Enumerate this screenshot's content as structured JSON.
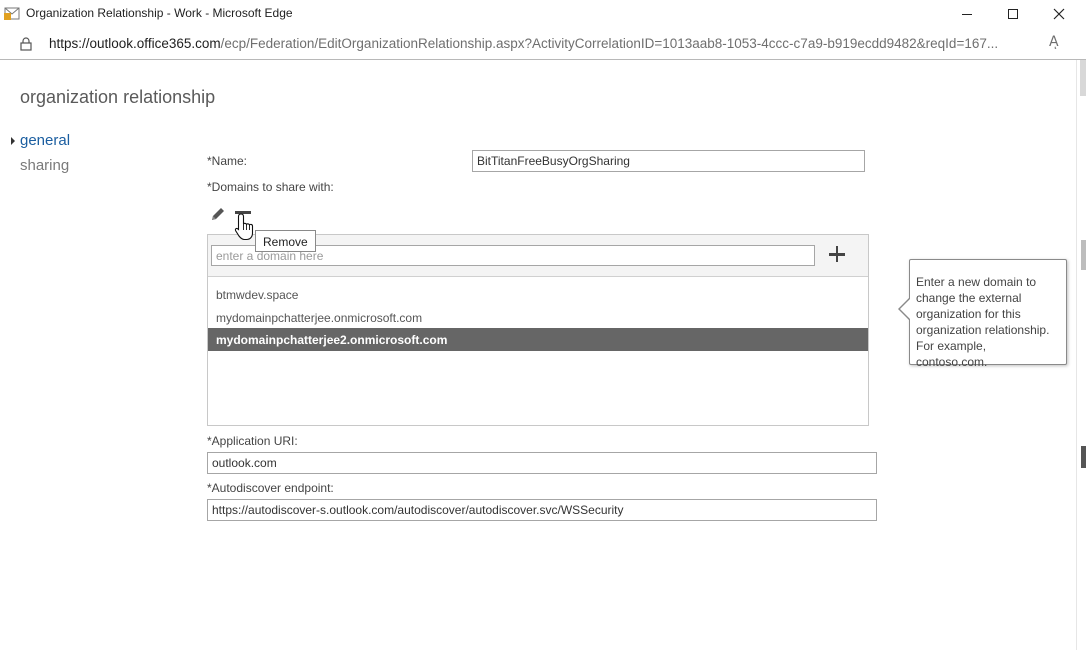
{
  "window": {
    "title": "Organization Relationship - Work - Microsoft Edge",
    "url_host": "https://outlook.office365.com",
    "url_rest": "/ecp/Federation/EditOrganizationRelationship.aspx?ActivityCorrelationID=1013aab8-1053-4ccc-c7a9-b919ecdd9482&reqId=167...",
    "read_aloud_glyph": "Aͅ"
  },
  "page": {
    "title": "organization relationship",
    "nav": [
      {
        "label": "general",
        "selected": true
      },
      {
        "label": "sharing",
        "selected": false
      }
    ]
  },
  "form": {
    "name_label": "*Name:",
    "name_value": "BitTitanFreeBusyOrgSharing",
    "domains_label": "*Domains to share with:",
    "domain_input_placeholder": "enter a domain here",
    "domains": [
      "btmwdev.space",
      "mydomainpchatterjee.onmicrosoft.com",
      "mydomainpchatterjee2.onmicrosoft.com"
    ],
    "selected_domain_index": 2,
    "app_uri_label": "*Application URI:",
    "app_uri_value": "outlook.com",
    "autodiscover_label": "*Autodiscover endpoint:",
    "autodiscover_value": "https://autodiscover-s.outlook.com/autodiscover/autodiscover.svc/WSSecurity"
  },
  "tooltip": {
    "remove": "Remove"
  },
  "callout": {
    "text": "Enter a new domain to change the external organization for this organization relationship. For example, contoso.com."
  },
  "icons": {
    "edit": "pencil-icon",
    "remove": "minus-icon",
    "add": "plus-icon"
  }
}
